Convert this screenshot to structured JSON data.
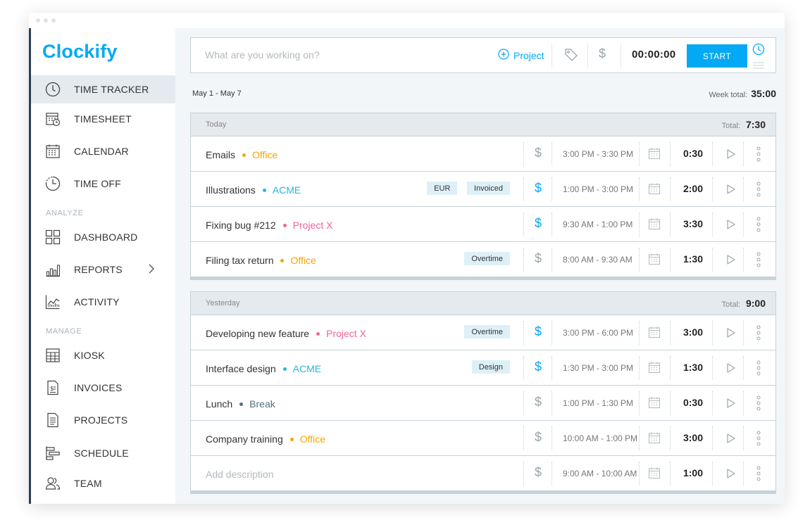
{
  "app": {
    "logo": "Clockify"
  },
  "sidebar": {
    "items": [
      {
        "label": "TIME TRACKER",
        "icon": "clock-icon",
        "active": true
      },
      {
        "label": "TIMESHEET",
        "icon": "timesheet-icon"
      },
      {
        "label": "CALENDAR",
        "icon": "calendar-icon"
      },
      {
        "label": "TIME OFF",
        "icon": "time-off-icon"
      },
      {
        "label": "DASHBOARD",
        "icon": "dashboard-icon"
      },
      {
        "label": "REPORTS",
        "icon": "reports-icon",
        "has_submenu": true
      },
      {
        "label": "ACTIVITY",
        "icon": "activity-icon"
      },
      {
        "label": "KIOSK",
        "icon": "kiosk-icon"
      },
      {
        "label": "INVOICES",
        "icon": "invoices-icon"
      },
      {
        "label": "PROJECTS",
        "icon": "projects-icon"
      },
      {
        "label": "SCHEDULE",
        "icon": "schedule-icon"
      },
      {
        "label": "TEAM",
        "icon": "team-icon"
      }
    ],
    "sections": {
      "analyze": "ANALYZE",
      "manage": "MANAGE"
    }
  },
  "timer": {
    "placeholder": "What are you working on?",
    "project_label": "Project",
    "billable_symbol": "$",
    "elapsed": "00:00:00",
    "start_label": "START"
  },
  "week": {
    "range": "May 1 - May 7",
    "total_label": "Week total:",
    "total": "35:00"
  },
  "groups": [
    {
      "title": "Today",
      "total_label": "Total:",
      "total": "7:30",
      "entries": [
        {
          "description": "Emails",
          "project": "Office",
          "project_color": "#f5a500",
          "tags": [],
          "billable": false,
          "time_range": "3:00 PM - 3:30 PM",
          "duration": "0:30"
        },
        {
          "description": "Illustrations",
          "project": "ACME",
          "project_color": "#29b6e0",
          "tags": [
            "EUR",
            "Invoiced"
          ],
          "billable": true,
          "time_range": "1:00 PM - 3:00 PM",
          "duration": "2:00"
        },
        {
          "description": "Fixing bug #212",
          "project": "Project X",
          "project_color": "#f0649a",
          "tags": [],
          "billable": true,
          "time_range": "9:30 AM - 1:00 PM",
          "duration": "3:30"
        },
        {
          "description": "Filing tax return",
          "project": "Office",
          "project_color": "#f5a500",
          "tags": [
            "Overtime"
          ],
          "billable": false,
          "time_range": "8:00 AM - 9:30 AM",
          "duration": "1:30"
        }
      ]
    },
    {
      "title": "Yesterday",
      "total_label": "Total:",
      "total": "9:00",
      "entries": [
        {
          "description": "Developing new feature",
          "project": "Project X",
          "project_color": "#f0649a",
          "tags": [
            "Overtime"
          ],
          "billable": true,
          "time_range": "3:00 PM - 6:00 PM",
          "duration": "3:00"
        },
        {
          "description": "Interface design",
          "project": "ACME",
          "project_color": "#29b6e0",
          "tags": [
            "Design"
          ],
          "billable": true,
          "time_range": "1:30 PM - 3:00 PM",
          "duration": "1:30"
        },
        {
          "description": "Lunch",
          "project": "Break",
          "project_color": "#56707c",
          "tags": [],
          "billable": false,
          "time_range": "1:00 PM - 1:30 PM",
          "duration": "0:30"
        },
        {
          "description": "Company training",
          "project": "Office",
          "project_color": "#f5a500",
          "tags": [],
          "billable": false,
          "time_range": "10:00 AM - 1:00 PM",
          "duration": "3:00"
        },
        {
          "description": "",
          "placeholder": "Add description",
          "project": "",
          "project_color": "",
          "tags": [],
          "billable": false,
          "time_range": "9:00 AM - 10:00 AM",
          "duration": "1:00"
        }
      ]
    }
  ],
  "colors": {
    "accent": "#03a9f4",
    "billable_off": "#9aa5ab",
    "billable_on": "#03a9f4",
    "tag_bg": "#def0f7"
  }
}
